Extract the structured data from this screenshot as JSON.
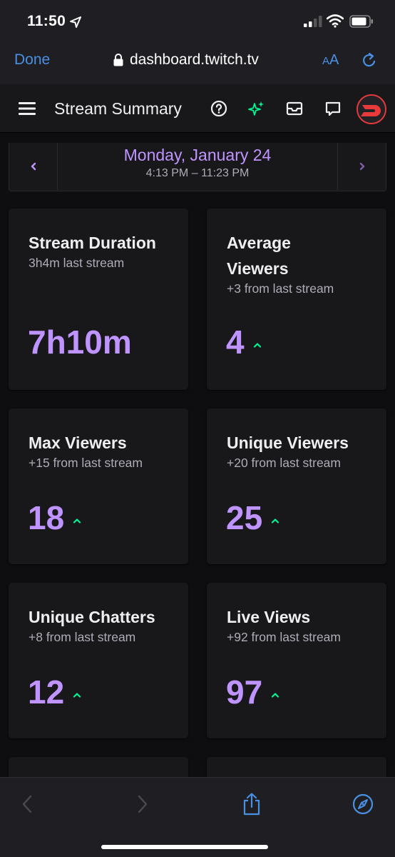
{
  "status_bar": {
    "time": "11:50"
  },
  "safari": {
    "done_label": "Done",
    "url": "dashboard.twitch.tv",
    "aa_label_small": "A",
    "aa_label_large": "A"
  },
  "header": {
    "title": "Stream Summary",
    "avatar_letter": "D"
  },
  "date_nav": {
    "date": "Monday, January 24",
    "time_range": "4:13 PM – 11:23 PM"
  },
  "stats": [
    {
      "title": "Stream Duration",
      "subtitle": "3h4m last stream",
      "value": "7h10m"
    },
    {
      "title": "Average Viewers",
      "subtitle": "+3 from last stream",
      "value": "4"
    },
    {
      "title": "Max Viewers",
      "subtitle": "+15 from last stream",
      "value": "18"
    },
    {
      "title": "Unique Viewers",
      "subtitle": "+20 from last stream",
      "value": "25"
    },
    {
      "title": "Unique Chatters",
      "subtitle": "+8 from last stream",
      "value": "12"
    },
    {
      "title": "Live Views",
      "subtitle": "+92 from last stream",
      "value": "97"
    }
  ],
  "colors": {
    "accent": "#bf94ff",
    "background": "#0e0e10",
    "card": "#18181b",
    "positive": "#00f593",
    "ios_blue": "#4a90e2"
  },
  "icons": {
    "location": "location-arrow-icon",
    "signal": "cellular-signal-icon",
    "wifi": "wifi-icon",
    "battery": "battery-icon",
    "lock": "lock-icon",
    "reload": "reload-icon",
    "menu": "hamburger-menu-icon",
    "help": "help-icon",
    "sparkle": "sparkle-icon",
    "inbox": "inbox-icon",
    "whispers": "chat-bubble-icon",
    "back": "back-chevron-icon",
    "forward": "forward-chevron-icon",
    "share": "share-icon",
    "compass": "compass-icon"
  }
}
